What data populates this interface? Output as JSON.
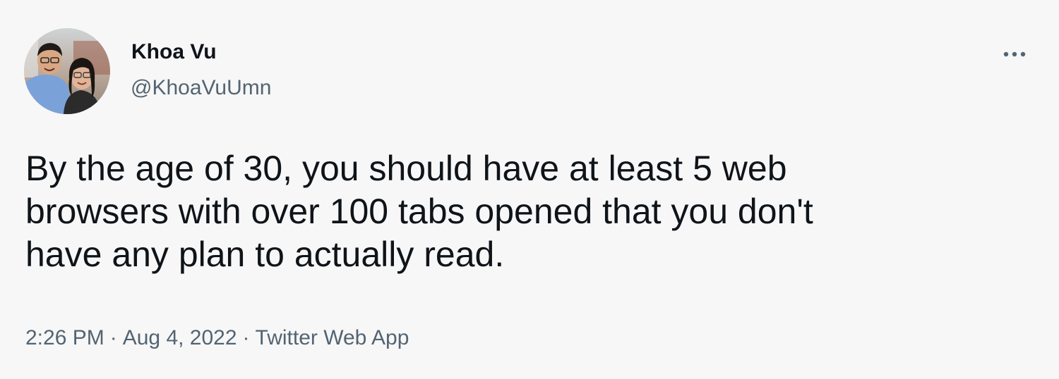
{
  "tweet": {
    "author": {
      "name": "Khoa Vu",
      "handle": "@KhoaVuUmn",
      "avatar_icon": "profile-photo-two-people"
    },
    "more_icon": "more-horizontal-icon",
    "text_lines": [
      "By the age of 30, you should have at least 5 web",
      "browsers with over 100 tabs opened that you don't",
      "have any plan to actually read."
    ],
    "time": "2:26 PM",
    "date": "Aug 4, 2022",
    "source": "Twitter Web App",
    "separator": "·"
  },
  "colors": {
    "background": "#f7f7f8",
    "text": "#0f1419",
    "secondary_text": "#536471"
  }
}
